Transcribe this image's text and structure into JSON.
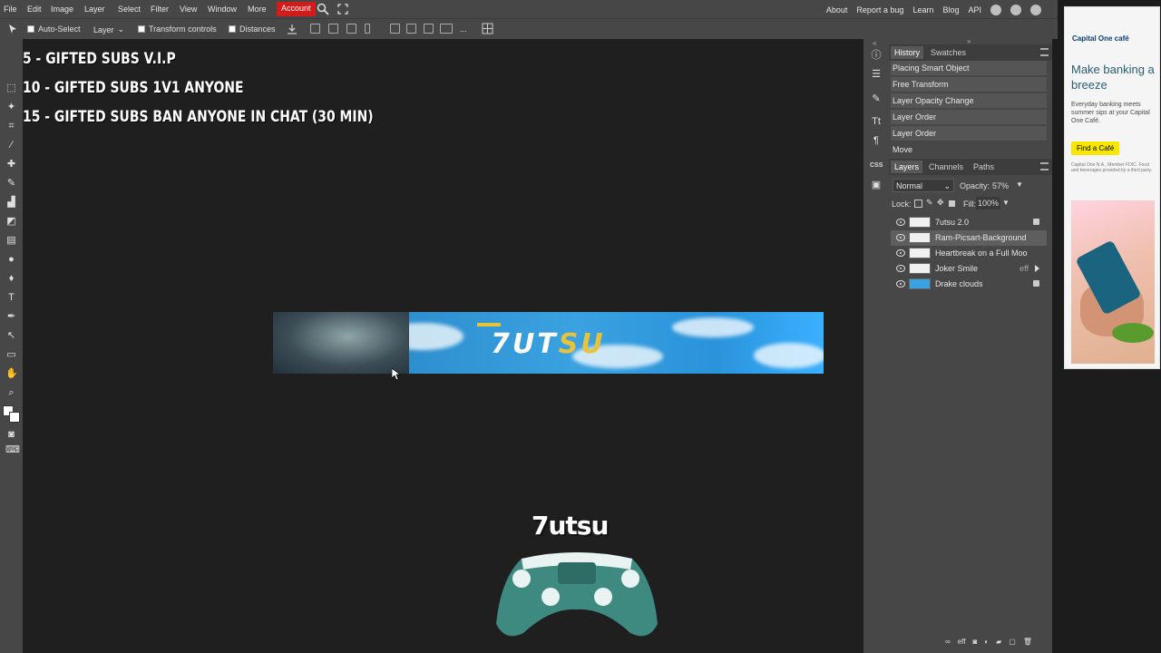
{
  "menubar": {
    "items": [
      "File",
      "Edit",
      "Image",
      "Layer",
      "Select",
      "Filter",
      "View",
      "Window",
      "More"
    ],
    "account_label": "Account",
    "right_links": [
      "About",
      "Report a bug",
      "Learn",
      "Blog",
      "API"
    ]
  },
  "options": {
    "auto_select": "Auto-Select",
    "layer_select": "Layer",
    "transform_controls": "Transform controls",
    "distances": "Distances",
    "more": "..."
  },
  "overlay": {
    "line1": "5 - GIFTED SUBS V.I.P",
    "line2": "10 - GIFTED SUBS 1V1 ANYONE",
    "line3": "15 - GIFTED SUBS BAN ANYONE IN CHAT (30 MIN)"
  },
  "canvas": {
    "banner_text_white": "7UT",
    "banner_text_gold": "SU",
    "controller_logo": "7utsu"
  },
  "side_strip": {
    "css_label": "CSS"
  },
  "history": {
    "tab_history": "History",
    "tab_swatches": "Swatches",
    "items": [
      "Placing Smart Object",
      "Free Transform",
      "Layer Opacity Change",
      "Layer Order",
      "Layer Order",
      "Move"
    ]
  },
  "layers": {
    "tab_layers": "Layers",
    "tab_channels": "Channels",
    "tab_paths": "Paths",
    "blend_mode": "Normal",
    "opacity_label": "Opacity:",
    "opacity_value": "57%",
    "lock_label": "Lock:",
    "fill_label": "Fill:",
    "fill_value": "100%",
    "rows": [
      {
        "name": "7utsu 2.0"
      },
      {
        "name": "Ram-Picsart-Background"
      },
      {
        "name": "Heartbreak on a Full Moo"
      },
      {
        "name": "Joker Smile",
        "eff": "eff"
      },
      {
        "name": "Drake clouds"
      }
    ],
    "footer_eff": "eff"
  },
  "ad": {
    "brand": "Capital One café",
    "headline": "Make banking a breeze",
    "body": "Everyday banking meets summer sips at your Capital One Café.",
    "cta": "Find a Café",
    "fine_print": "Capital One N.A., Member FDIC. Food and beverages provided by a third party."
  },
  "colors": {
    "account_red": "#d21b1b",
    "panel_bg": "#474747",
    "workspace_bg": "#1f1f1f",
    "ad_cta_yellow": "#f6e600"
  }
}
